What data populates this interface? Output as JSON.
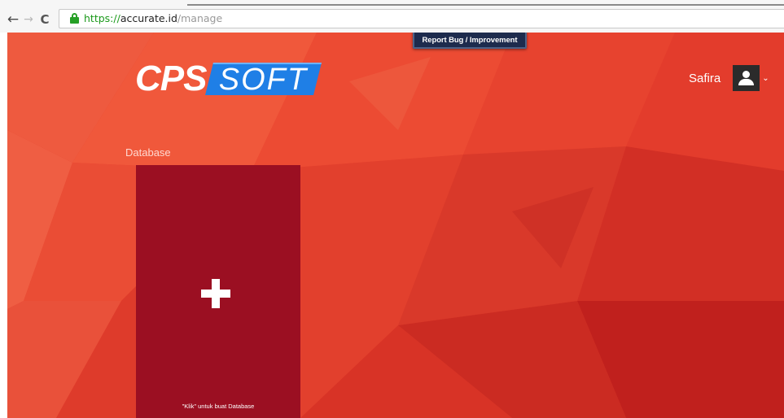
{
  "browser": {
    "nav": {
      "back_glyph": "←",
      "forward_glyph": "→",
      "reload_glyph": "C"
    },
    "url": {
      "scheme": "https://",
      "host": "accurate.id",
      "path": "/manage"
    },
    "icons": {
      "secure": "lock-icon"
    },
    "colors": {
      "secure": "#26a026"
    }
  },
  "header": {
    "report_button": "Report Bug / Improvement",
    "logo": {
      "part1": "CPS",
      "part2": "SOFT"
    },
    "user": {
      "name": "Safira",
      "avatar_icon": "user-icon",
      "chevron": "⌄"
    }
  },
  "main": {
    "section_label": "Database",
    "create_card": {
      "icon": "plus-icon",
      "caption": "\"Klik\" untuk buat Database"
    }
  },
  "colors": {
    "background": "#e8432f",
    "card": "#9b0f22",
    "logo_accent": "#1f7fe6",
    "report_button": "#1d2b4d"
  }
}
